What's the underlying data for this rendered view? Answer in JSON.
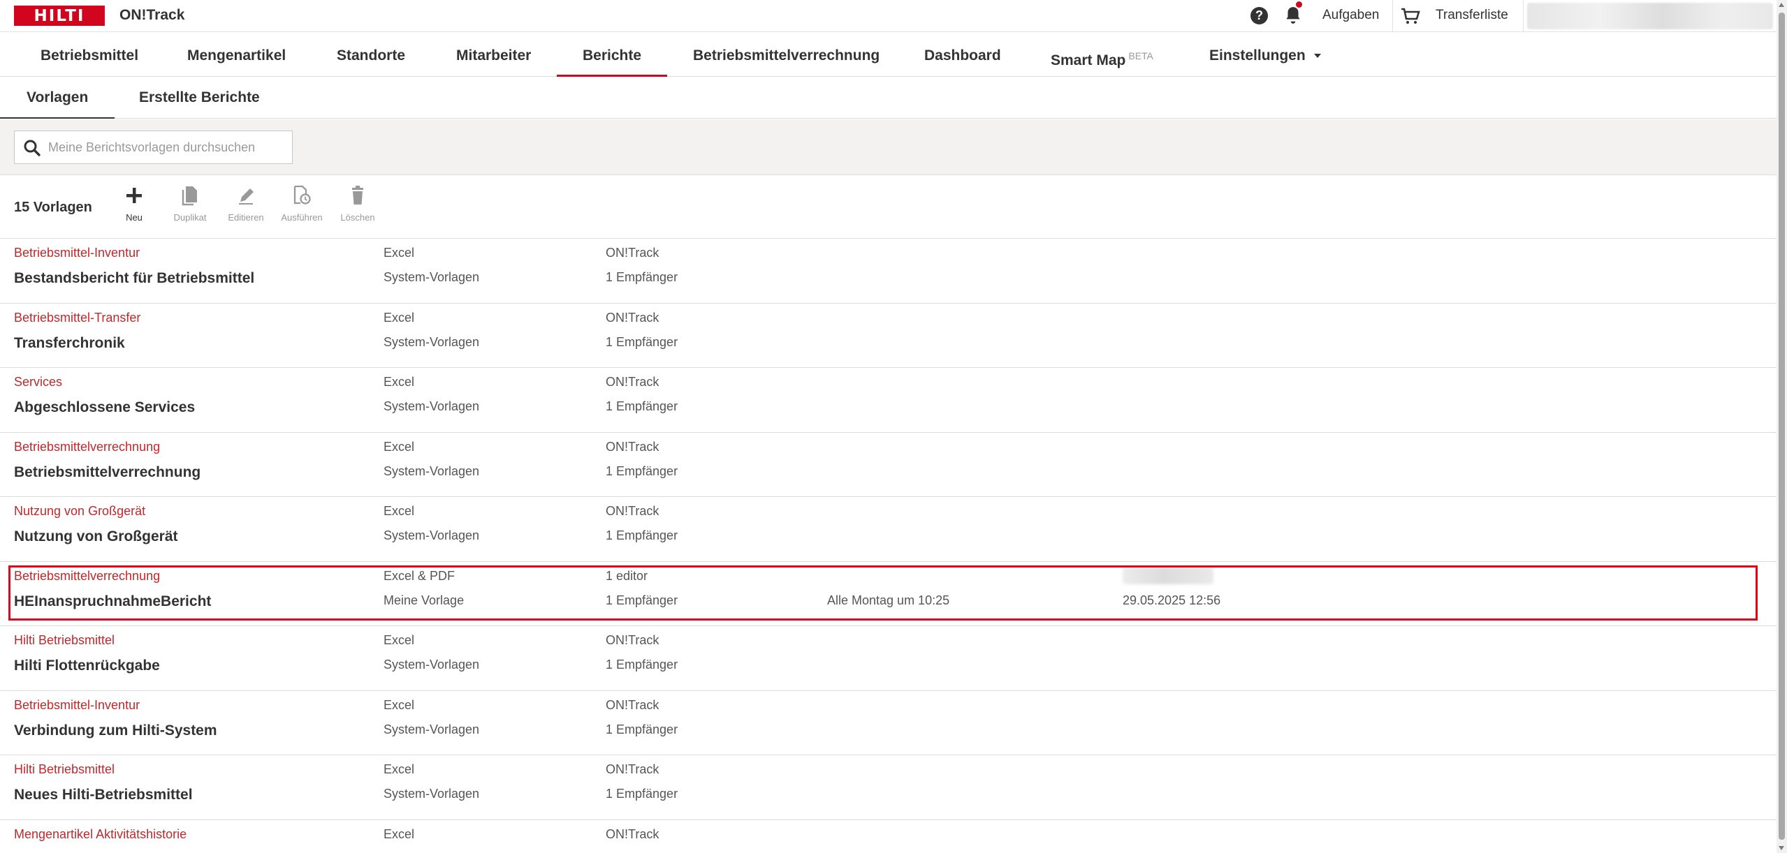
{
  "header": {
    "logo_text": "HILTI",
    "app_title": "ON!Track",
    "tasks_label": "Aufgaben",
    "transfer_label": "Transferliste",
    "brand_color": "#d2051e"
  },
  "nav": {
    "items": [
      {
        "label": "Betriebsmittel"
      },
      {
        "label": "Mengenartikel"
      },
      {
        "label": "Standorte"
      },
      {
        "label": "Mitarbeiter"
      },
      {
        "label": "Berichte",
        "active": true
      },
      {
        "label": "Betriebsmittelverrechnung"
      },
      {
        "label": "Dashboard"
      },
      {
        "label": "Smart Map",
        "badge": "BETA"
      },
      {
        "label": "Einstellungen",
        "dropdown": true
      }
    ]
  },
  "subtabs": [
    {
      "label": "Vorlagen",
      "active": true
    },
    {
      "label": "Erstellte Berichte"
    }
  ],
  "search": {
    "placeholder": "Meine Berichtsvorlagen durchsuchen",
    "value": ""
  },
  "toolbar": {
    "count": "15 Vorlagen",
    "actions": [
      {
        "label": "Neu",
        "icon": "plus-icon",
        "enabled": true
      },
      {
        "label": "Duplikat",
        "icon": "duplicate-icon",
        "enabled": false
      },
      {
        "label": "Editieren",
        "icon": "pencil-icon",
        "enabled": false
      },
      {
        "label": "Ausführen",
        "icon": "run-report-icon",
        "enabled": false
      },
      {
        "label": "Löschen",
        "icon": "trash-icon",
        "enabled": false
      }
    ]
  },
  "rows": [
    {
      "category": "Betriebsmittel-Inventur",
      "name": "Bestandsbericht für Betriebsmittel",
      "format": "Excel",
      "source": "System-Vorlagen",
      "owner": "ON!Track",
      "recipients": "1 Empfänger",
      "schedule": "",
      "date": ""
    },
    {
      "category": "Betriebsmittel-Transfer",
      "name": "Transferchronik",
      "format": "Excel",
      "source": "System-Vorlagen",
      "owner": "ON!Track",
      "recipients": "1 Empfänger",
      "schedule": "",
      "date": ""
    },
    {
      "category": "Services",
      "name": "Abgeschlossene Services",
      "format": "Excel",
      "source": "System-Vorlagen",
      "owner": "ON!Track",
      "recipients": "1 Empfänger",
      "schedule": "",
      "date": ""
    },
    {
      "category": "Betriebsmittelverrechnung",
      "name": "Betriebsmittelverrechnung",
      "format": "Excel",
      "source": "System-Vorlagen",
      "owner": "ON!Track",
      "recipients": "1 Empfänger",
      "schedule": "",
      "date": ""
    },
    {
      "category": "Nutzung von Großgerät",
      "name": "Nutzung von Großgerät",
      "format": "Excel",
      "source": "System-Vorlagen",
      "owner": "ON!Track",
      "recipients": "1 Empfänger",
      "schedule": "",
      "date": ""
    },
    {
      "category": "Betriebsmittelverrechnung",
      "name": "HEInanspruchnahmeBericht",
      "format": "Excel & PDF",
      "source": "Meine Vorlage",
      "owner": "1 editor",
      "recipients": "1 Empfänger",
      "schedule": "Alle Montag um 10:25",
      "date": "29.05.2025 12:56",
      "highlighted": true
    },
    {
      "category": "Hilti Betriebsmittel",
      "name": "Hilti Flottenrückgabe",
      "format": "Excel",
      "source": "System-Vorlagen",
      "owner": "ON!Track",
      "recipients": "1 Empfänger",
      "schedule": "",
      "date": ""
    },
    {
      "category": "Betriebsmittel-Inventur",
      "name": "Verbindung zum Hilti-System",
      "format": "Excel",
      "source": "System-Vorlagen",
      "owner": "ON!Track",
      "recipients": "1 Empfänger",
      "schedule": "",
      "date": ""
    },
    {
      "category": "Hilti Betriebsmittel",
      "name": "Neues Hilti-Betriebsmittel",
      "format": "Excel",
      "source": "System-Vorlagen",
      "owner": "ON!Track",
      "recipients": "1 Empfänger",
      "schedule": "",
      "date": ""
    },
    {
      "category": "Mengenartikel Aktivitätshistorie",
      "name": "",
      "format": "Excel",
      "source": "",
      "owner": "ON!Track",
      "recipients": "",
      "schedule": "",
      "date": ""
    }
  ],
  "colors": {
    "accent": "#d2051e",
    "category_text": "#c0282b",
    "highlight_border": "#e2041b"
  }
}
